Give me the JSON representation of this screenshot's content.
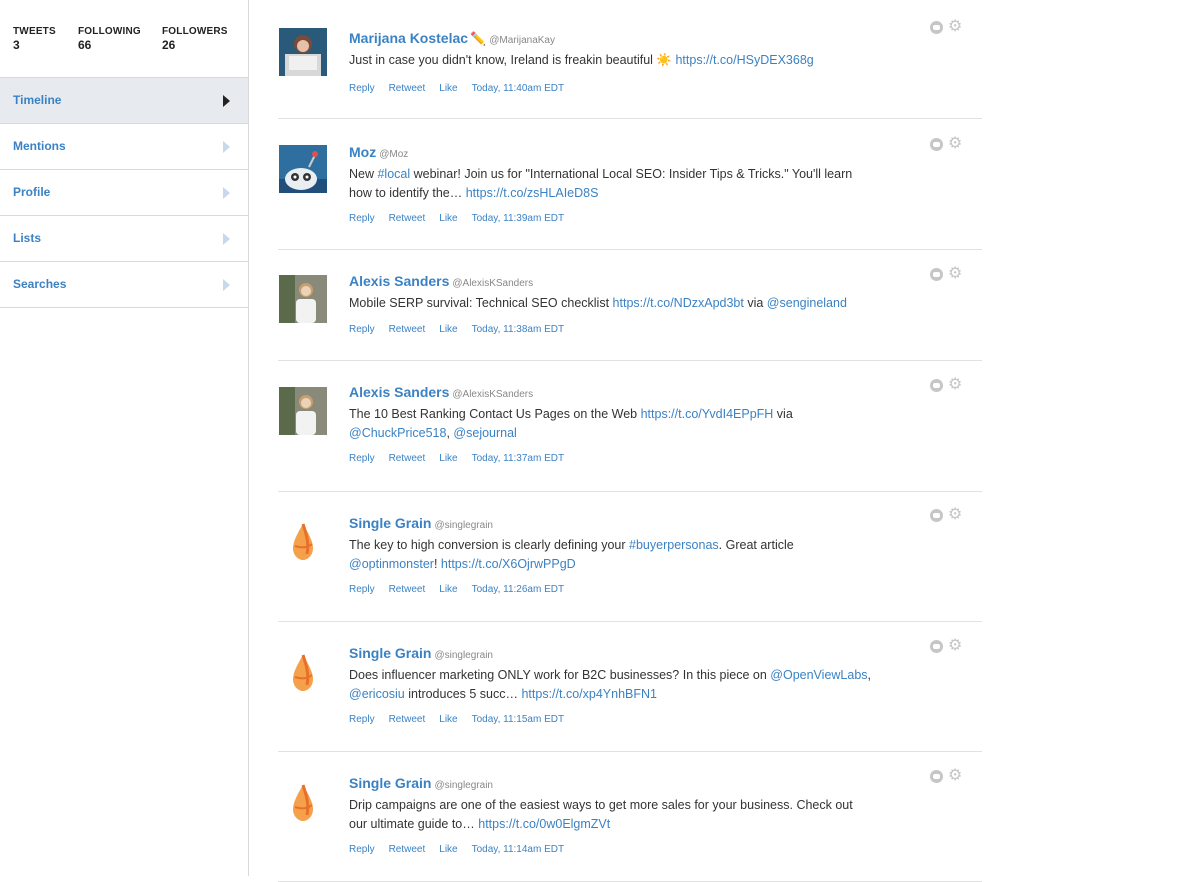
{
  "stats": {
    "tweets_label": "TWEETS",
    "tweets": "3",
    "following_label": "FOLLOWING",
    "following": "66",
    "followers_label": "FOLLOWERS",
    "followers": "26"
  },
  "nav": [
    {
      "label": "Timeline",
      "active": true
    },
    {
      "label": "Mentions"
    },
    {
      "label": "Profile"
    },
    {
      "label": "Lists"
    },
    {
      "label": "Searches"
    }
  ],
  "actions": {
    "reply": "Reply",
    "retweet": "Retweet",
    "like": "Like"
  },
  "icons": {
    "status": "chat-bubble-icon",
    "settings": "gear-icon"
  },
  "colors": {
    "accent": "#3b82c4",
    "active_nav_bg": "#e7ebf0"
  },
  "tweets": [
    {
      "name": "Marijana Kostelac",
      "emoji": "✏️",
      "handle": "@MarijanaKay",
      "lines": [
        [
          {
            "t": "Just in case you didn't know, Ireland is freakin beautiful ☀️ "
          },
          {
            "t": "https://t.co/HSyDEX368g",
            "l": true
          }
        ]
      ],
      "time": "Today, 11:40am EDT",
      "avatar": "person-dark"
    },
    {
      "name": "Moz",
      "emoji": "",
      "handle": "@Moz",
      "lines": [
        [
          {
            "t": "New "
          },
          {
            "t": "#local",
            "l": true
          },
          {
            "t": " webinar! Join us for \"International Local SEO: Insider Tips & Tricks.\" You'll learn"
          }
        ],
        [
          {
            "t": "how to identify the… "
          },
          {
            "t": "https://t.co/zsHLAIeD8S",
            "l": true
          }
        ]
      ],
      "time": "Today, 11:39am EDT",
      "avatar": "robot"
    },
    {
      "name": "Alexis Sanders",
      "emoji": "",
      "handle": "@AlexisKSanders",
      "lines": [
        [
          {
            "t": "Mobile SERP survival: Technical SEO checklist "
          },
          {
            "t": "https://t.co/NDzxApd3bt",
            "l": true
          },
          {
            "t": " via "
          },
          {
            "t": "@sengineland",
            "l": true
          }
        ]
      ],
      "time": "Today, 11:38am EDT",
      "avatar": "person-light"
    },
    {
      "name": "Alexis Sanders",
      "emoji": "",
      "handle": "@AlexisKSanders",
      "lines": [
        [
          {
            "t": "The 10 Best Ranking Contact Us Pages on the Web "
          },
          {
            "t": "https://t.co/YvdI4EPpFH",
            "l": true
          },
          {
            "t": " via"
          }
        ],
        [
          {
            "t": "@ChuckPrice518",
            "l": true
          },
          {
            "t": ", "
          },
          {
            "t": "@sejournal",
            "l": true
          }
        ]
      ],
      "time": "Today, 11:37am EDT",
      "avatar": "person-light"
    },
    {
      "name": "Single Grain",
      "emoji": "",
      "handle": "@singlegrain",
      "lines": [
        [
          {
            "t": "The key to high conversion is clearly defining your "
          },
          {
            "t": "#buyerpersonas",
            "l": true
          },
          {
            "t": ". Great article"
          }
        ],
        [
          {
            "t": "@optinmonster",
            "l": true
          },
          {
            "t": "! "
          },
          {
            "t": "https://t.co/X6OjrwPPgD",
            "l": true
          }
        ]
      ],
      "time": "Today, 11:26am EDT",
      "avatar": "grain"
    },
    {
      "name": "Single Grain",
      "emoji": "",
      "handle": "@singlegrain",
      "lines": [
        [
          {
            "t": "Does influencer marketing ONLY work for B2C businesses? In this piece on "
          },
          {
            "t": "@OpenViewLabs",
            "l": true
          },
          {
            "t": ","
          }
        ],
        [
          {
            "t": "@ericosiu",
            "l": true
          },
          {
            "t": " introduces 5 succ… "
          },
          {
            "t": "https://t.co/xp4YnhBFN1",
            "l": true
          }
        ]
      ],
      "time": "Today, 11:15am EDT",
      "avatar": "grain"
    },
    {
      "name": "Single Grain",
      "emoji": "",
      "handle": "@singlegrain",
      "lines": [
        [
          {
            "t": "Drip campaigns are one of the easiest ways to get more sales for your business. Check out"
          }
        ],
        [
          {
            "t": "our ultimate guide to… "
          },
          {
            "t": "https://t.co/0w0ElgmZVt",
            "l": true
          }
        ]
      ],
      "time": "Today, 11:14am EDT",
      "avatar": "grain"
    }
  ]
}
